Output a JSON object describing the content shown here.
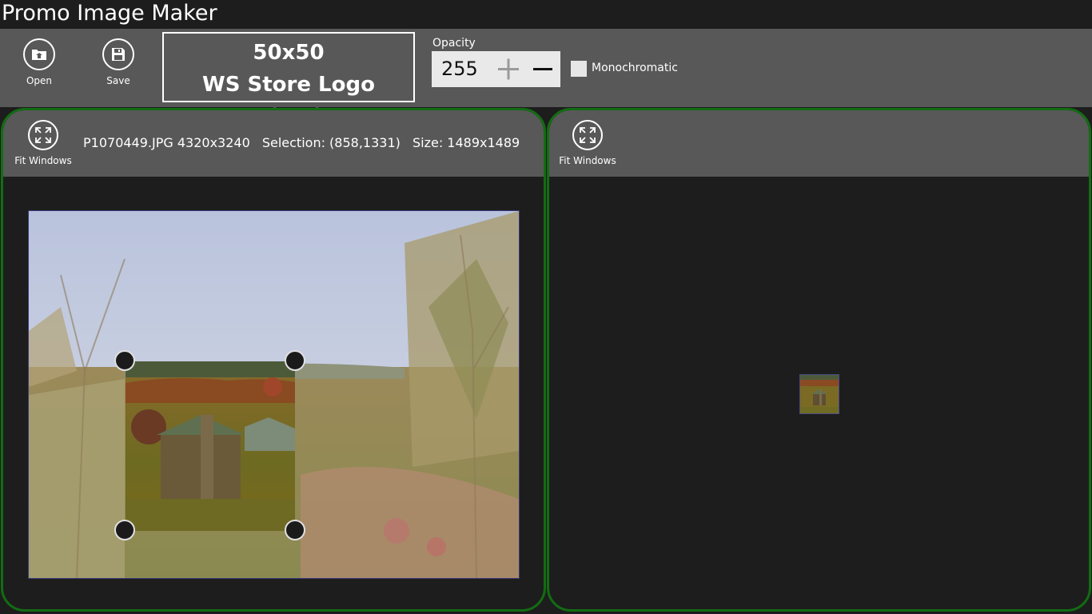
{
  "app": {
    "title": "Promo Image Maker"
  },
  "toolbar": {
    "open_label": "Open",
    "save_label": "Save",
    "preset": {
      "size": "50x50",
      "name": "WS Store Logo 50x50"
    },
    "opacity": {
      "label": "Opacity",
      "value": "255"
    },
    "monochromatic": {
      "label": "Monochromatic",
      "checked": false
    }
  },
  "source_panel": {
    "fit_label": "Fit Windows",
    "file_info": "P1070449.JPG 4320x3240",
    "selection": "Selection: (858,1331)",
    "size": "Size: 1489x1489"
  },
  "preview_panel": {
    "fit_label": "Fit Windows"
  },
  "colors": {
    "panel_border": "#126c12",
    "toolbar_bg": "#585858",
    "app_bg": "#1d1d1d"
  }
}
